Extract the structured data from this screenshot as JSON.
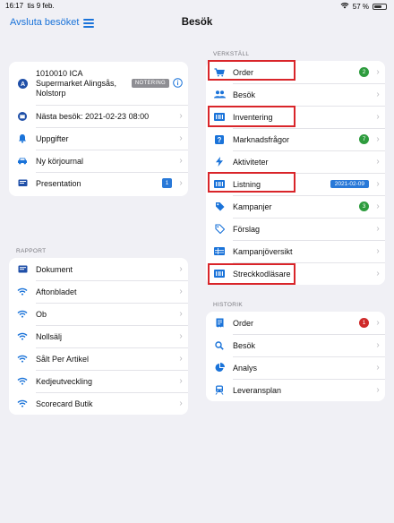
{
  "status": {
    "time": "16:17",
    "date": "tis 9 feb.",
    "battery": "57 %"
  },
  "nav": {
    "back": "Avsluta besöket",
    "title": "Besök"
  },
  "customer": {
    "name_line1": "1010010 ICA",
    "name_line2": "Supermarket Alingsås,",
    "name_line3": "Nolstorp",
    "badge": "NOTERING",
    "rows": [
      {
        "label": "Nästa besök: 2021-02-23 08:00"
      },
      {
        "label": "Uppgifter"
      },
      {
        "label": "Ny körjournal"
      },
      {
        "label": "Presentation",
        "count": "1"
      }
    ]
  },
  "rapport": {
    "header": "RAPPORT",
    "items": [
      "Dokument",
      "Aftonbladet",
      "Ob",
      "Nollsälj",
      "Sålt Per Artikel",
      "Kedjeutveckling",
      "Scorecard Butik"
    ]
  },
  "verkstall": {
    "header": "VERKSTÄLL",
    "items": [
      {
        "label": "Order",
        "count": "2"
      },
      {
        "label": "Besök"
      },
      {
        "label": "Inventering"
      },
      {
        "label": "Marknadsfrågor",
        "count": "7"
      },
      {
        "label": "Aktiviteter"
      },
      {
        "label": "Listning",
        "date": "2021-02-09"
      },
      {
        "label": "Kampanjer",
        "count": "3"
      },
      {
        "label": "Förslag"
      },
      {
        "label": "Kampanjöversikt"
      },
      {
        "label": "Streckkodläsare"
      }
    ]
  },
  "historik": {
    "header": "HISTORIK",
    "items": [
      {
        "label": "Order",
        "count": "1"
      },
      {
        "label": "Besök"
      },
      {
        "label": "Analys"
      },
      {
        "label": "Leveransplan"
      }
    ]
  },
  "colors": {
    "accent": "#1a73d9",
    "green": "#2e9c3e",
    "red": "#cf2a2a",
    "highlight": "#d9252a"
  }
}
